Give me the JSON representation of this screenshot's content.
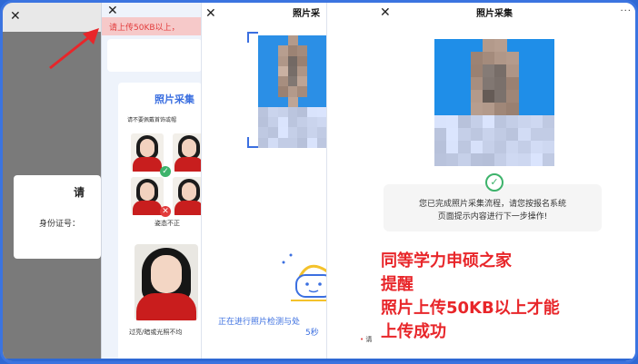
{
  "panel1": {
    "close_glyph": "✕",
    "dialog_title": "请",
    "id_label": "身份证号："
  },
  "panel2": {
    "close_glyph": "✕",
    "warning_banner": "请上传50KB以上，",
    "card_title": "照片采集",
    "card_note": "请不要佩戴首饰或帽",
    "posture_caption": "姿态不正",
    "lighting_caption": "过亮/暗或光照不均"
  },
  "panel3": {
    "close_glyph": "✕",
    "title": "照片采",
    "scan_text": "正在进行照片检测与处",
    "scan_seconds": "5秒",
    "bottom_note": "请"
  },
  "panel4": {
    "close_glyph": "✕",
    "title": "照片采集",
    "more_glyph": "···",
    "done_line1": "您已完成照片采集流程，请您按报名系统",
    "done_line2": "页面提示内容进行下一步操作!",
    "check_glyph": "✓"
  },
  "overlay": {
    "line1": "同等学力申硕之家",
    "line2": "提醒",
    "line3": "照片上传50KB以上才能",
    "line4": "上传成功",
    "color": "#e8262a"
  },
  "colors": {
    "accent_blue": "#3b6fe0",
    "success_green": "#3db36b",
    "error_red": "#e23b3b",
    "frame_blue": "#2f69d4"
  }
}
